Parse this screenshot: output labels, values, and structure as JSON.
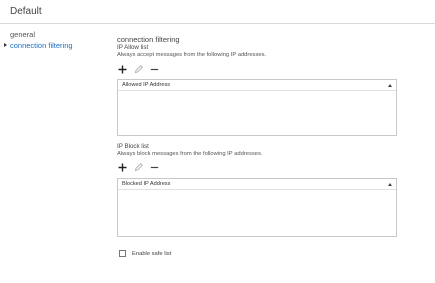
{
  "window": {
    "title": "Default"
  },
  "nav": {
    "items": [
      {
        "label": "general"
      },
      {
        "label": "connection filtering"
      }
    ]
  },
  "main": {
    "section_title": "connection filtering",
    "allow": {
      "label": "IP Allow list",
      "description": "Always accept messages from the following IP addresses.",
      "column_header": "Allowed IP Address",
      "rows": []
    },
    "block": {
      "label": "IP Block list",
      "description": "Always block messages from the following IP addresses.",
      "column_header": "Blocked IP Address",
      "rows": []
    },
    "safe_list": {
      "label": "Enable safe list",
      "checked": false
    }
  },
  "icons": {
    "add": "plus-icon",
    "edit": "pencil-icon",
    "remove": "minus-icon",
    "sort": "sort-ascending-icon"
  },
  "colors": {
    "accent": "#1f6fc5",
    "text": "#333333",
    "border": "#c8c8c8"
  }
}
